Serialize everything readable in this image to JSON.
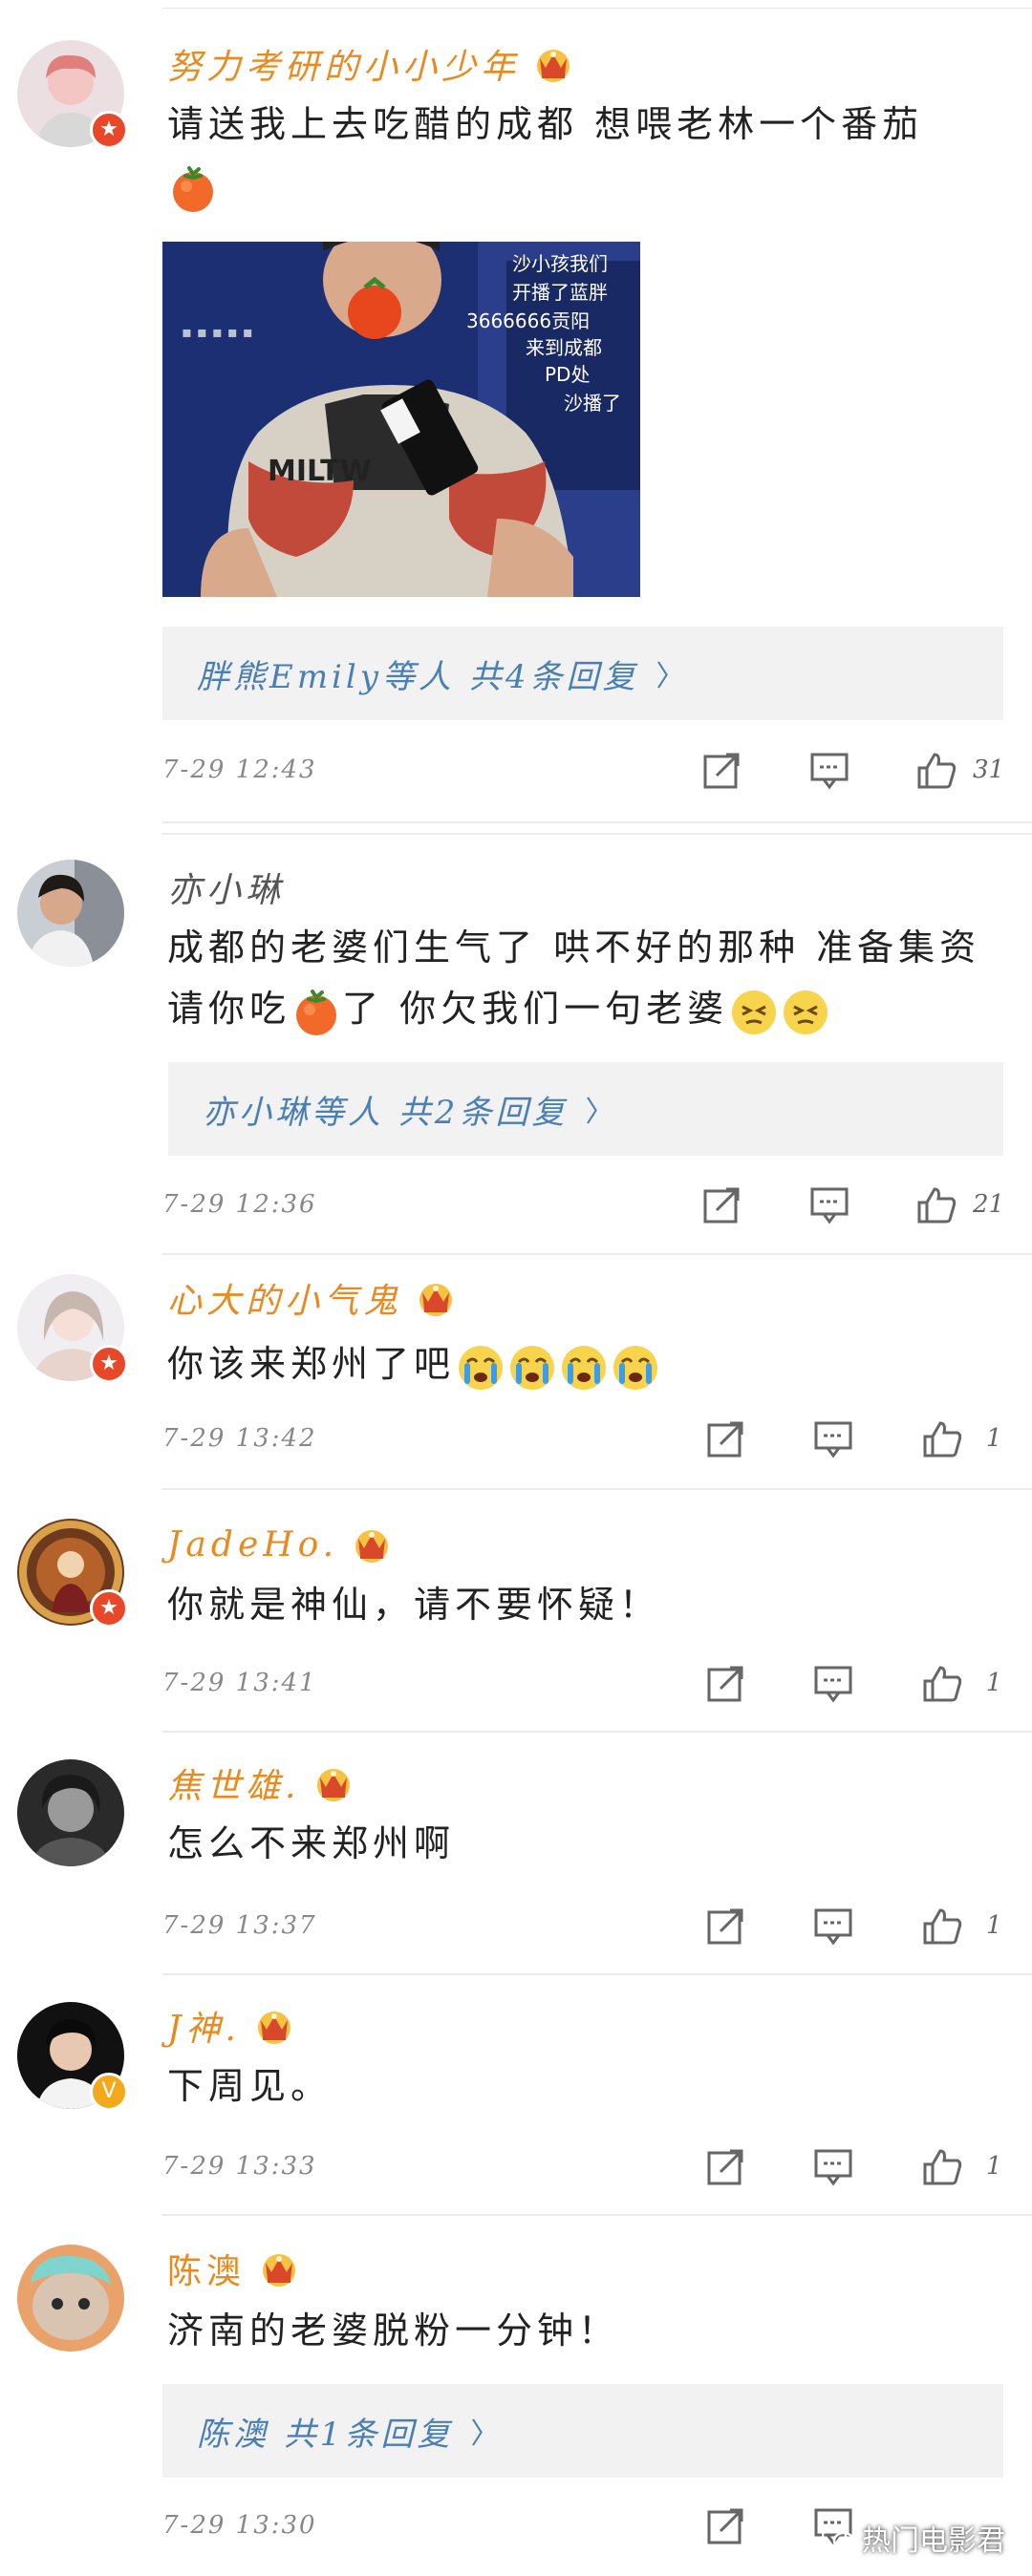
{
  "comments": [
    {
      "username": "努力考研的小小少年",
      "content_before": "请送我上去吃醋的成都 想喂老林一个番茄",
      "replies": "胖熊Emily等人 共4条回复",
      "time": "7-29 12:43",
      "likes": "31"
    },
    {
      "username": "亦小琳",
      "content_before": "成都的老婆们生气了 哄不好的那种 准备集资请你吃",
      "content_after": "了 你欠我们一句老婆",
      "replies": "亦小琳等人 共2条回复",
      "time": "7-29 12:36",
      "likes": "21"
    },
    {
      "username": "心大的小气鬼",
      "content_before": "你该来郑州了吧",
      "time": "7-29 13:42",
      "likes": "1"
    },
    {
      "username": "JadeHo.",
      "content_before": "你就是神仙，请不要怀疑！",
      "time": "7-29 13:41",
      "likes": "1"
    },
    {
      "username": "焦世雄.",
      "content_before": "怎么不来郑州啊",
      "time": "7-29 13:37",
      "likes": "1"
    },
    {
      "username": "J神.",
      "content_before": "下周见。",
      "time": "7-29 13:33",
      "likes": "1"
    },
    {
      "username": "陈澳",
      "content_before": "济南的老婆脱粉一分钟！",
      "replies": "陈澳 共1条回复",
      "time": "7-29 13:30"
    }
  ],
  "photo_overlay": {
    "line1": "沙小孩我们",
    "line2": "开播了蓝胖",
    "line3": "3666666贡阳",
    "line4": "来到成都",
    "line5": "PD处",
    "line6": "沙播了",
    "shirt": "MILTW"
  },
  "watermark": "热门电影君",
  "colors": {
    "vip_name": "#e88a1f",
    "link_blue": "#4a7fb5",
    "badge_red": "#e8472a",
    "badge_gold": "#f4a91d"
  }
}
